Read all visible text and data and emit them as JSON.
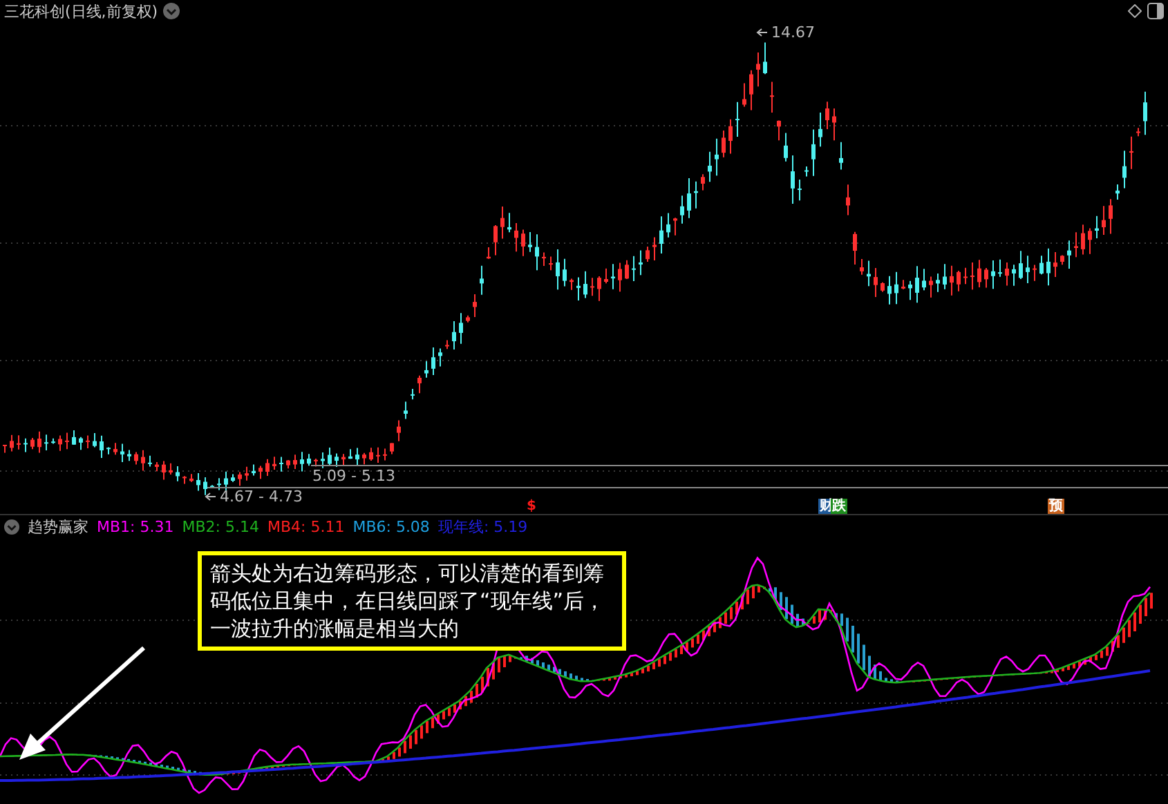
{
  "chart_title": "三花科创(日线,前复权)",
  "price_labels": {
    "high": "14.67",
    "low": "4.67 - 4.73",
    "range": "5.09 - 5.13"
  },
  "event_markers": [
    {
      "text": "$",
      "color": "#ff1a1a"
    },
    {
      "text": "财",
      "color": "#1f5a9a"
    },
    {
      "text": "跌",
      "color": "#1f8f1f"
    },
    {
      "text": "预",
      "color": "#c8621e"
    }
  ],
  "indicator": {
    "name": "趋势赢家",
    "legend": [
      {
        "label": "MB1: 5.31",
        "color": "#ff00ff"
      },
      {
        "label": "MB2: 5.14",
        "color": "#1fb21f"
      },
      {
        "label": "MB4: 5.11",
        "color": "#ff2020"
      },
      {
        "label": "MB6: 5.08",
        "color": "#1ea0e0"
      },
      {
        "label": "现年线: 5.19",
        "color": "#2020e0"
      }
    ]
  },
  "annotation": "箭头处为右边筹码形态，可以清楚的看到筹码低位且集中，在日线回踩了“现年线”后，一波拉升的涨幅是相当大的"
}
